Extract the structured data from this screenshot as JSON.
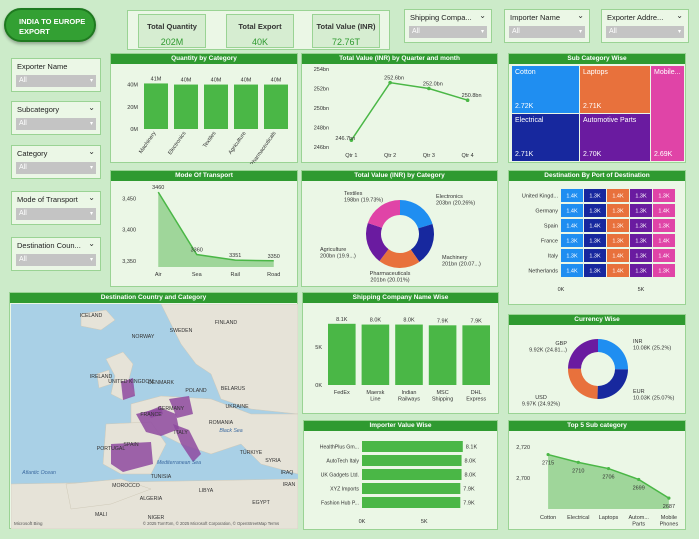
{
  "title": "INDIA TO EUROPE EXPORT",
  "kpis": [
    {
      "label": "Total Quantity",
      "value": "202M"
    },
    {
      "label": "Total Export",
      "value": "40K"
    },
    {
      "label": "Total Value (INR)",
      "value": "72.76T"
    }
  ],
  "top_slicers": [
    {
      "label": "Shipping Compa...",
      "value": "All"
    },
    {
      "label": "Importer Name",
      "value": "All"
    },
    {
      "label": "Exporter Addre...",
      "value": "All"
    }
  ],
  "left_slicers": [
    {
      "label": "Exporter Name",
      "value": "All"
    },
    {
      "label": "Subcategory",
      "value": "All"
    },
    {
      "label": "Category",
      "value": "All"
    },
    {
      "label": "Mode of Transport",
      "value": "All"
    },
    {
      "label": "Destination Coun...",
      "value": "All"
    }
  ],
  "colors": {
    "green": "#2f9a30",
    "bar": "#4ab746",
    "light": "#ebf7e6"
  },
  "panels": {
    "qty_by_category": "Quantity by Category",
    "value_by_quarter": "Total Value (INR) by Quarter and month",
    "subcategory_wise": "Sub Category Wise",
    "mode_of_transport": "Mode Of Transport",
    "value_by_category": "Total Value (INR) by Category",
    "destination_by_port": "Destination By Port of Destination",
    "dest_country_category": "Destination Country and Category",
    "shipping_company": "Shipping Company Name Wise",
    "currency_wise": "Currency Wise",
    "importer_value": "Importer Value Wise",
    "top5_sub": "Top 5 Sub category"
  },
  "qty_chart": {
    "yticks": [
      "0M",
      "20M",
      "40M"
    ],
    "categories": [
      "Machinery",
      "Electronics",
      "Textiles",
      "Agriculture",
      "Pharmaceuticals"
    ],
    "labels": [
      "41M",
      "40M",
      "40M",
      "40M",
      "40M"
    ],
    "values": [
      41,
      40,
      40,
      40,
      40
    ],
    "ymax": 45
  },
  "quarter_chart": {
    "yticks": [
      "246bn",
      "248bn",
      "250bn",
      "252bn",
      "254bn"
    ],
    "yvals": [
      246,
      248,
      250,
      252,
      254
    ],
    "categories": [
      "Qtr 1",
      "Qtr 2",
      "Qtr 3",
      "Qtr 4"
    ],
    "labels": [
      "246.7bn",
      "252.6bn",
      "252.0bn",
      "250.8bn"
    ],
    "values": [
      246.7,
      252.6,
      252.0,
      250.8
    ]
  },
  "treemap": [
    {
      "label": "Cotton",
      "value": "2.72K",
      "color": "#1f8ef1"
    },
    {
      "label": "Laptops",
      "value": "2.71K",
      "color": "#e8713c"
    },
    {
      "label": "Mobile...",
      "value": "2.69K",
      "color": "#e044a7"
    },
    {
      "label": "Electrical",
      "value": "2.71K",
      "color": "#17289e"
    },
    {
      "label": "Automotive Parts",
      "value": "2.70K",
      "color": "#6a1ba0"
    }
  ],
  "transport_chart": {
    "yticks": [
      "3,350",
      "3,400",
      "3,450"
    ],
    "yvals": [
      3350,
      3400,
      3450
    ],
    "categories": [
      "Air",
      "Sea",
      "Rail",
      "Road"
    ],
    "labels": [
      "3460",
      "3360",
      "3351",
      "3350"
    ],
    "values": [
      3460,
      3360,
      3351,
      3350
    ]
  },
  "category_donut": {
    "slices": [
      {
        "name": "Electronics",
        "label": "Electronics\n203bn (20.26%)",
        "value": 20.26,
        "color": "#1f8ef1"
      },
      {
        "name": "Machinery",
        "label": "Machinery\n201bn (20.07...)",
        "value": 20.07,
        "color": "#17289e"
      },
      {
        "name": "Pharmaceuticals",
        "label": "Pharmaceuticals\n201bn (20.01%)",
        "value": 20.01,
        "color": "#e8713c"
      },
      {
        "name": "Agriculture",
        "label": "Agriculture\n200bn (19.9...)",
        "value": 19.93,
        "color": "#6a1ba0"
      },
      {
        "name": "Textiles",
        "label": "Textiles\n198bn (19.73%)",
        "value": 19.73,
        "color": "#e044a7"
      }
    ]
  },
  "port_matrix": {
    "rows": [
      "United Kingd...",
      "Germany",
      "Spain",
      "France",
      "Italy",
      "Netherlands"
    ],
    "cells": [
      [
        "1.4K",
        "1.3K",
        "1.4K",
        "1.3K",
        "1.3K"
      ],
      [
        "1.4K",
        "1.3K",
        "1.3K",
        "1.3K",
        "1.4K"
      ],
      [
        "1.4K",
        "1.4K",
        "1.3K",
        "1.3K",
        "1.3K"
      ],
      [
        "1.3K",
        "1.3K",
        "1.3K",
        "1.3K",
        "1.4K"
      ],
      [
        "1.3K",
        "1.3K",
        "1.4K",
        "1.3K",
        "1.4K"
      ],
      [
        "1.4K",
        "1.3K",
        "1.4K",
        "1.3K",
        "1.3K"
      ]
    ],
    "colors": [
      "#1f8ef1",
      "#17289e",
      "#e8713c",
      "#6a1ba0",
      "#e044a7"
    ],
    "xticks": [
      "0K",
      "5K"
    ]
  },
  "map": {
    "labels": [
      "ICELAND",
      "NORWAY",
      "SWEDEN",
      "FINLAND",
      "UNITED KINGDOM",
      "IRELAND",
      "DENMARK",
      "BELARUS",
      "POLAND",
      "UKRAINE",
      "GERMANY",
      "FRANCE",
      "ROMANIA",
      "ITALY",
      "SPAIN",
      "PORTUGAL",
      "Black Sea",
      "TÜRKIYE",
      "SYRIA",
      "IRAQ",
      "Mediterranean Sea",
      "TUNISIA",
      "MOROCCO",
      "ALGERIA",
      "LIBYA",
      "EGYPT",
      "MALI",
      "NIGER",
      "Atlantic Ocean",
      "IRAN"
    ],
    "credit": "© 2025 TomTom, © 2025 Microsoft Corporation, © OpenStreetMap Terms",
    "bing": "Microsoft Bing"
  },
  "shipping_chart": {
    "yticks": [
      "0K",
      "5K"
    ],
    "categories": [
      "FedEx",
      "Maersk\nLine",
      "Indian\nRailways",
      "MSC\nShipping",
      "DHL\nExpress"
    ],
    "labels": [
      "8.1K",
      "8.0K",
      "8.0K",
      "7.9K",
      "7.9K"
    ],
    "values": [
      8.1,
      8.0,
      8.0,
      7.9,
      7.9
    ],
    "ymax": 9
  },
  "currency_donut": {
    "slices": [
      {
        "name": "INR",
        "label": "INR\n10.08K (25.2%)",
        "value": 25.2,
        "color": "#1f8ef1"
      },
      {
        "name": "EUR",
        "label": "EUR\n10.03K (25.07%)",
        "value": 25.07,
        "color": "#17289e"
      },
      {
        "name": "USD",
        "label": "USD\n9.97K (24.92%)",
        "value": 24.92,
        "color": "#e8713c"
      },
      {
        "name": "GBP",
        "label": "GBP\n9.92K (24.81...)",
        "value": 24.81,
        "color": "#6a1ba0"
      }
    ]
  },
  "importer_chart": {
    "categories": [
      "HealthPlus Gm...",
      "AutoTech Italy",
      "UK Gadgets Ltd.",
      "XYZ Imports",
      "Fashion Hub P..."
    ],
    "labels": [
      "8.1K",
      "8.0K",
      "8.0K",
      "7.9K",
      "7.9K"
    ],
    "values": [
      8.1,
      8.0,
      8.0,
      7.9,
      7.9
    ],
    "xticks": [
      "0K",
      "5K"
    ],
    "xmax": 9
  },
  "top5_chart": {
    "yticks": [
      "2,700",
      "2,720"
    ],
    "yvals": [
      2700,
      2720
    ],
    "categories": [
      "Cotton",
      "Electrical",
      "Laptops",
      "Autom...\nParts",
      "Mobile\nPhones"
    ],
    "labels": [
      "2715",
      "2710",
      "2706",
      "2699",
      "2687"
    ],
    "values": [
      2715,
      2710,
      2706,
      2699,
      2687
    ]
  }
}
